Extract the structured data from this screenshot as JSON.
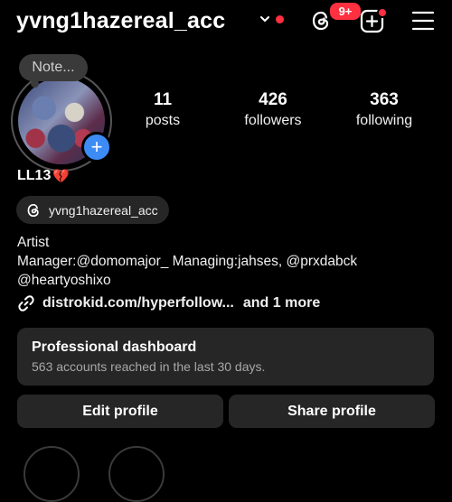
{
  "header": {
    "username": "yvng1hazereal_acc",
    "threads_badge": "9+"
  },
  "profile": {
    "note_label": "Note...",
    "stats": [
      {
        "value": "11",
        "label": "posts"
      },
      {
        "value": "426",
        "label": "followers"
      },
      {
        "value": "363",
        "label": "following"
      }
    ],
    "display_name": "LL13",
    "display_name_emoji": "💔",
    "threads_handle": "yvng1hazereal_acc",
    "bio_lines": [
      "Artist",
      "Manager:@domomajor_ Managing:jahses, @prxdabck",
      "@heartyoshixo"
    ],
    "link_text": "distrokid.com/hyperfollow...",
    "link_more": "and 1 more"
  },
  "dashboard": {
    "title": "Professional dashboard",
    "subtitle": "563 accounts reached in the last 30 days."
  },
  "actions": {
    "edit_label": "Edit profile",
    "share_label": "Share profile"
  },
  "colors": {
    "background": "#000000",
    "surface": "#262626",
    "accent_blue": "#3d8bf5",
    "notification_red": "#ff3040"
  }
}
